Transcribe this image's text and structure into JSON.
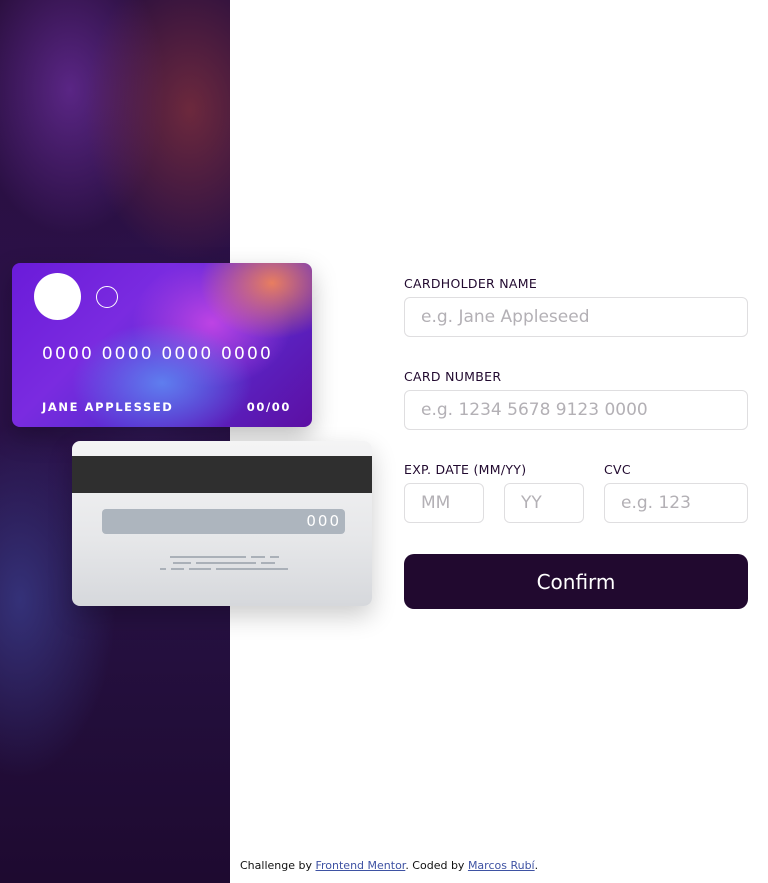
{
  "card_front": {
    "number": "0000 0000 0000 0000",
    "name": "JANE APPLESSED",
    "expiry": "00/00"
  },
  "card_back": {
    "cvc": "000"
  },
  "form": {
    "cardholder_label": "CARDHOLDER NAME",
    "cardholder_placeholder": "e.g. Jane Appleseed",
    "number_label": "CARD NUMBER",
    "number_placeholder": "e.g. 1234 5678 9123 0000",
    "exp_label": "EXP. DATE (MM/YY)",
    "month_placeholder": "MM",
    "year_placeholder": "YY",
    "cvc_label": "CVC",
    "cvc_placeholder": "e.g. 123",
    "confirm_label": "Confirm"
  },
  "footer": {
    "prefix": "Challenge by ",
    "link1": "Frontend Mentor",
    "middle": ". Coded by ",
    "link2": "Marcos Rubí",
    "suffix": "."
  },
  "colors": {
    "dark_violet": "#21092f",
    "input_border": "#dfdee0",
    "placeholder": "#b3b0b5",
    "link": "#3e52a3"
  }
}
